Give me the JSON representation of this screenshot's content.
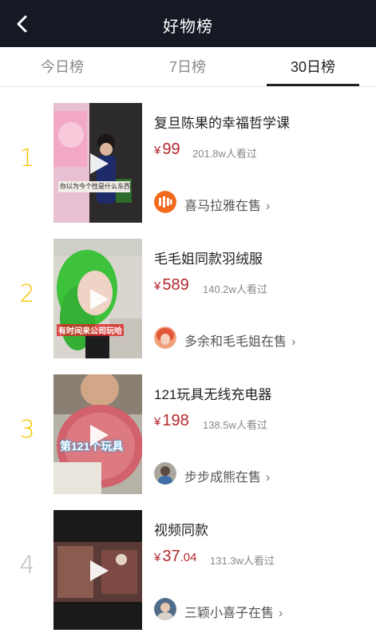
{
  "header": {
    "title": "好物榜"
  },
  "tabs": [
    {
      "label": "今日榜"
    },
    {
      "label": "7日榜"
    },
    {
      "label": "30日榜",
      "active": true
    }
  ],
  "colors": {
    "header_bg": "#161823",
    "price": "#b3262d",
    "rank_gold": "#f5c300",
    "rank_gray": "#b9b9b9"
  },
  "items": [
    {
      "rank": "1",
      "name": "复旦陈果的幸福哲学课",
      "currency": "¥",
      "price": "99",
      "price_cents": "",
      "views": "201.8w人看过",
      "seller": "喜马拉雅在售",
      "seller_icon": "ximalaya-logo-icon",
      "thumb_caption": "你以为今个性是什么东西？"
    },
    {
      "rank": "2",
      "name": "毛毛姐同款羽绒服",
      "currency": "¥",
      "price": "589",
      "price_cents": "",
      "views": "140.2w人看过",
      "seller": "多余和毛毛姐在售",
      "seller_icon": "seller-avatar",
      "thumb_caption": "有时间来公司玩哈"
    },
    {
      "rank": "3",
      "name": "121玩具无线充电器",
      "currency": "¥",
      "price": "198",
      "price_cents": "",
      "views": "138.5w人看过",
      "seller": "步步成熊在售",
      "seller_icon": "seller-avatar",
      "thumb_caption": "第121个玩具"
    },
    {
      "rank": "4",
      "name": "视频同款",
      "currency": "¥",
      "price": "37",
      "price_cents": ".04",
      "views": "131.3w人看过",
      "seller": "三颖小喜子在售",
      "seller_icon": "seller-avatar",
      "thumb_caption": ""
    }
  ]
}
